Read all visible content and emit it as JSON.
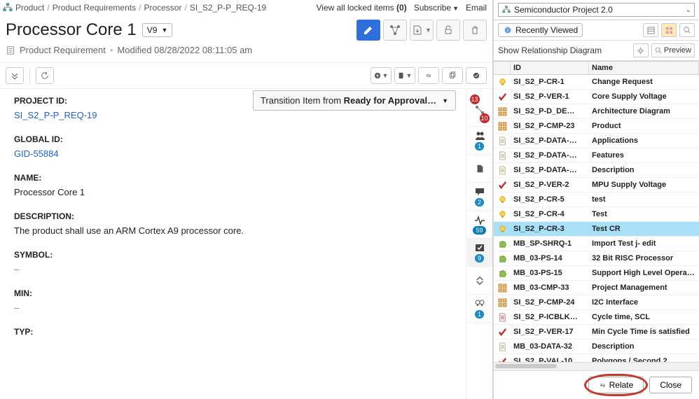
{
  "breadcrumb": [
    "Product",
    "Product Requirements",
    "Processor",
    "SI_S2_P-P_REQ-19"
  ],
  "header": {
    "view_locked": "View all locked items",
    "locked_count": "(0)",
    "subscribe": "Subscribe",
    "email": "Email",
    "title": "Processor Core 1",
    "version": "V9",
    "meta_type": "Product Requirement",
    "meta_modified": "Modified 08/28/2022 08:11:05 am"
  },
  "transition": {
    "prefix": "Transition Item from ",
    "bold": "Ready for Approval…"
  },
  "fields": {
    "project_id": {
      "label": "PROJECT ID:",
      "value": "SI_S2_P-P_REQ-19"
    },
    "global_id": {
      "label": "GLOBAL ID:",
      "value": "GID-55884"
    },
    "name": {
      "label": "NAME:",
      "value": "Processor Core 1"
    },
    "description": {
      "label": "DESCRIPTION:",
      "value": "The product shall use an ARM Cortex A9 processor core."
    },
    "symbol": {
      "label": "SYMBOL:",
      "value": "–"
    },
    "min": {
      "label": "MIN:",
      "value": "–"
    },
    "typ": {
      "label": "TYP:",
      "value": ""
    }
  },
  "sidebar_counts": {
    "rel_a": "13",
    "rel_b": "10",
    "people": "1",
    "comments": "2",
    "activity": "59",
    "verify": "9",
    "ideas": "1"
  },
  "right": {
    "project": "Semiconductor Project 2.0",
    "recently_viewed": "Recently Viewed",
    "subhdr": "Show Relationship Diagram",
    "preview": "Preview",
    "col_id": "ID",
    "col_name": "Name",
    "rows": [
      {
        "icon": "bulb-icon",
        "id": "SI_S2_P-CR-1",
        "name": "Change Request"
      },
      {
        "icon": "check-red-icon",
        "id": "SI_S2_P-VER-1",
        "name": "Core Supply Voltage"
      },
      {
        "icon": "grid-icon",
        "id": "SI_S2_P-D_DE…",
        "name": "Architecture Diagram"
      },
      {
        "icon": "grid-icon",
        "id": "SI_S2_P-CMP-23",
        "name": "Product"
      },
      {
        "icon": "doc-icon",
        "id": "SI_S2_P-DATA-…",
        "name": "Applications"
      },
      {
        "icon": "doc-icon",
        "id": "SI_S2_P-DATA-…",
        "name": "Features"
      },
      {
        "icon": "doc-icon",
        "id": "SI_S2_P-DATA-…",
        "name": "Description"
      },
      {
        "icon": "check-red-icon",
        "id": "SI_S2_P-VER-2",
        "name": "MPU Supply Voltage"
      },
      {
        "icon": "bulb-icon",
        "id": "SI_S2_P-CR-5",
        "name": "test"
      },
      {
        "icon": "bulb-icon",
        "id": "SI_S2_P-CR-4",
        "name": "Test"
      },
      {
        "icon": "bulb-icon",
        "id": "SI_S2_P-CR-3",
        "name": "Test CR",
        "selected": true
      },
      {
        "icon": "puzzle-icon",
        "id": "MB_SP-SHRQ-1",
        "name": "Import Test j- edit"
      },
      {
        "icon": "puzzle-icon",
        "id": "MB_03-PS-14",
        "name": "32 Bit RISC Processor"
      },
      {
        "icon": "puzzle-icon",
        "id": "MB_03-PS-15",
        "name": "Support High Level Operating"
      },
      {
        "icon": "grid-icon",
        "id": "MB_03-CMP-33",
        "name": "Project Management"
      },
      {
        "icon": "grid-icon",
        "id": "SI_S2_P-CMP-24",
        "name": "I2C Interface"
      },
      {
        "icon": "doc-red-icon",
        "id": "SI_S2_P-ICBLK…",
        "name": "Cycle time, SCL"
      },
      {
        "icon": "check-red-icon",
        "id": "SI_S2_P-VER-17",
        "name": "Min Cycle Time is satisfied"
      },
      {
        "icon": "doc-icon",
        "id": "MB_03-DATA-32",
        "name": "Description"
      },
      {
        "icon": "check-red-icon",
        "id": "SI_S2_P-VAL-10",
        "name": "Polygons / Second 2"
      }
    ],
    "relate_btn": "Relate",
    "close_btn": "Close"
  }
}
